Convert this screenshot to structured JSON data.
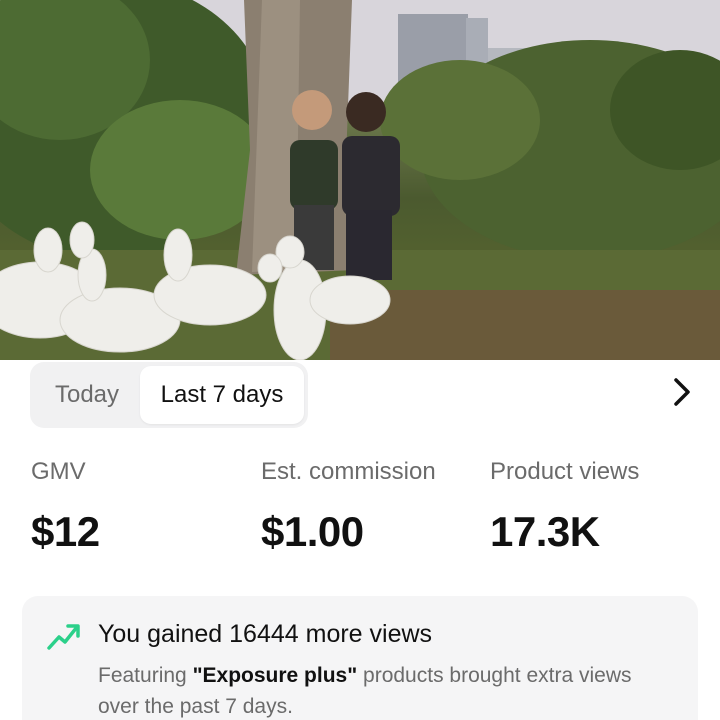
{
  "video": {
    "icon": "video-frame"
  },
  "tabs": [
    {
      "label": "Today",
      "selected": false
    },
    {
      "label": "Last 7 days",
      "selected": true
    }
  ],
  "nav": {
    "icon": "chevron-right-icon"
  },
  "metrics": [
    {
      "label": "GMV",
      "value": "$12"
    },
    {
      "label": "Est. commission",
      "value": "$1.00"
    },
    {
      "label": "Product views",
      "value": "17.3K"
    }
  ],
  "insight": {
    "icon": "trend-up-icon",
    "accent_color": "#2bd08a",
    "title": "You gained 16444 more views",
    "desc_prefix": "Featuring ",
    "desc_highlight": "\"Exposure plus\"",
    "desc_suffix": " products brought extra views over the past 7 days."
  }
}
